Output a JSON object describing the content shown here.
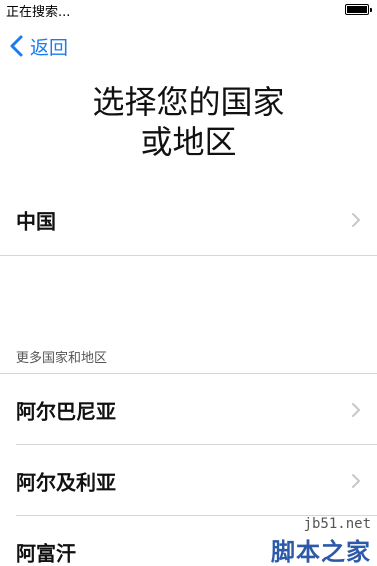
{
  "status_bar": {
    "text": "正在搜索..."
  },
  "nav": {
    "back_label": "返回"
  },
  "title": {
    "line1": "选择您的国家",
    "line2": "或地区"
  },
  "primary": {
    "label": "中国"
  },
  "section": {
    "header": "更多国家和地区"
  },
  "countries": [
    {
      "label": "阿尔巴尼亚"
    },
    {
      "label": "阿尔及利亚"
    },
    {
      "label": "阿富汗"
    }
  ],
  "watermark": {
    "url": "jb51.net",
    "text": "脚本之家"
  },
  "colors": {
    "accent": "#1a7cf5",
    "divider": "#d6d6d8",
    "chevron": "#c7c7cc"
  }
}
